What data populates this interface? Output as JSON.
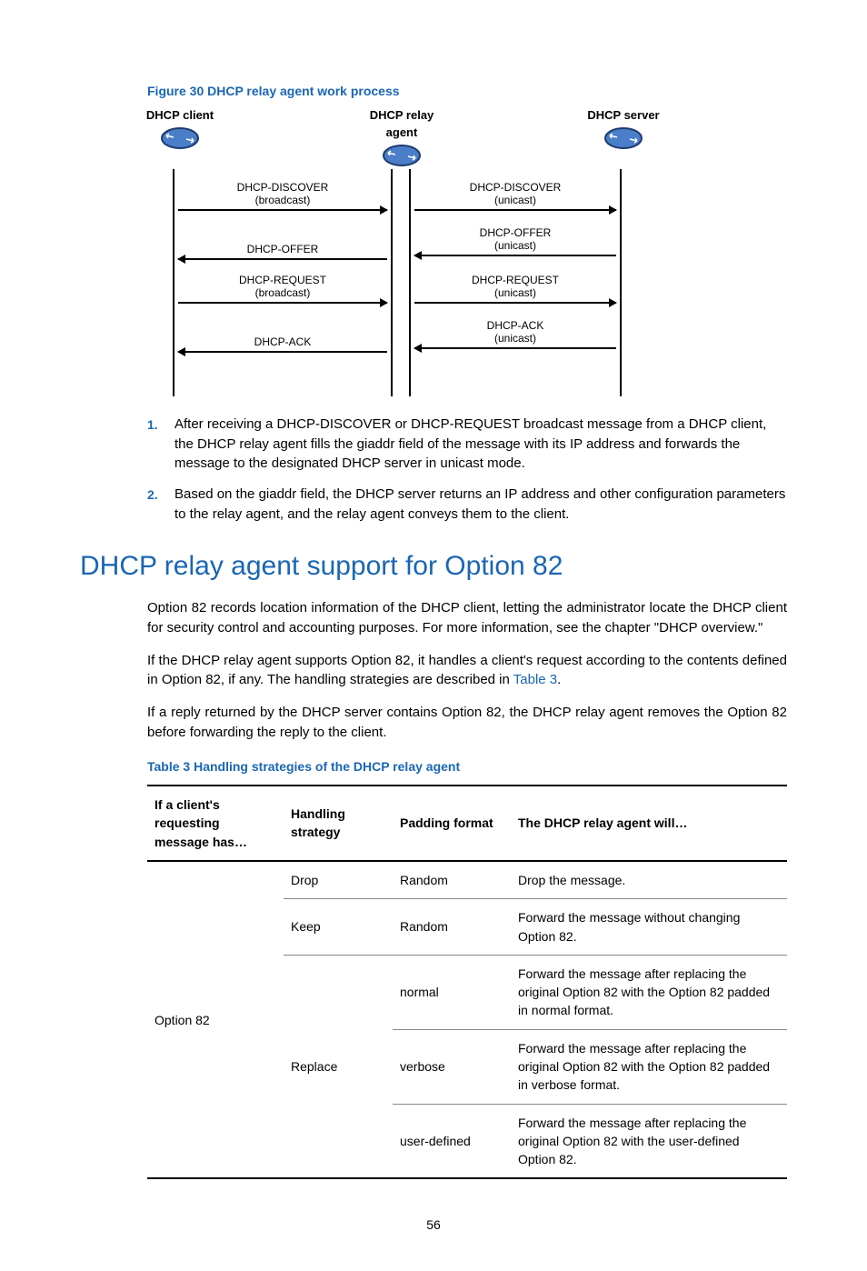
{
  "figure": {
    "caption": "Figure 30 DHCP relay agent work process",
    "nodes": {
      "client": "DHCP client",
      "relay": "DHCP relay agent",
      "server": "DHCP server"
    },
    "messages_left": [
      {
        "l1": "DHCP-DISCOVER",
        "l2": "(broadcast)",
        "dir": "right"
      },
      {
        "l1": "DHCP-OFFER",
        "l2": "",
        "dir": "left"
      },
      {
        "l1": "DHCP-REQUEST",
        "l2": "(broadcast)",
        "dir": "right"
      },
      {
        "l1": "DHCP-ACK",
        "l2": "",
        "dir": "left"
      }
    ],
    "messages_right": [
      {
        "l1": "DHCP-DISCOVER",
        "l2": "(unicast)",
        "dir": "right"
      },
      {
        "l1": "DHCP-OFFER",
        "l2": "(unicast)",
        "dir": "left"
      },
      {
        "l1": "DHCP-REQUEST",
        "l2": "(unicast)",
        "dir": "right"
      },
      {
        "l1": "DHCP-ACK",
        "l2": "(unicast)",
        "dir": "left"
      }
    ]
  },
  "steps": [
    {
      "num": "1.",
      "text": "After receiving a DHCP-DISCOVER or DHCP-REQUEST broadcast message from a DHCP client, the DHCP relay agent fills the giaddr field of the message with its IP address and forwards the message to the designated DHCP server in unicast mode."
    },
    {
      "num": "2.",
      "text": "Based on the giaddr field, the DHCP server returns an IP address and other configuration parameters to the relay agent, and the relay agent conveys them to the client."
    }
  ],
  "heading": "DHCP relay agent support for Option 82",
  "paras": {
    "p1": "Option 82 records location information of the DHCP client, letting the administrator locate the DHCP client for security control and accounting purposes. For more information, see the chapter \"DHCP overview.\"",
    "p2a": "If the DHCP relay agent supports Option 82, it handles a client's request according to the contents defined in Option 82, if any. The handling strategies are described in ",
    "p2link": "Table 3",
    "p2b": ".",
    "p3": "If a reply returned by the DHCP server contains Option 82, the DHCP relay agent removes the Option 82 before forwarding the reply to the client."
  },
  "table": {
    "caption": "Table 3 Handling strategies of the DHCP relay agent",
    "headers": {
      "c1": "If a client's requesting message has…",
      "c2": "Handling strategy",
      "c3": "Padding format",
      "c4": "The DHCP relay agent will…"
    },
    "col1": "Option 82",
    "rows": [
      {
        "strategy": "Drop",
        "format": "Random",
        "action": "Drop the message."
      },
      {
        "strategy": "Keep",
        "format": "Random",
        "action": "Forward the message without changing Option 82."
      },
      {
        "strategy": "Replace",
        "format": "normal",
        "action": "Forward the message after replacing the original Option 82 with the Option 82 padded in normal format."
      },
      {
        "strategy": "",
        "format": "verbose",
        "action": "Forward the message after replacing the original Option 82 with the Option 82 padded in verbose format."
      },
      {
        "strategy": "",
        "format": "user-defined",
        "action": "Forward the message after replacing the original Option 82 with the user-defined Option 82."
      }
    ]
  },
  "page_number": "56"
}
